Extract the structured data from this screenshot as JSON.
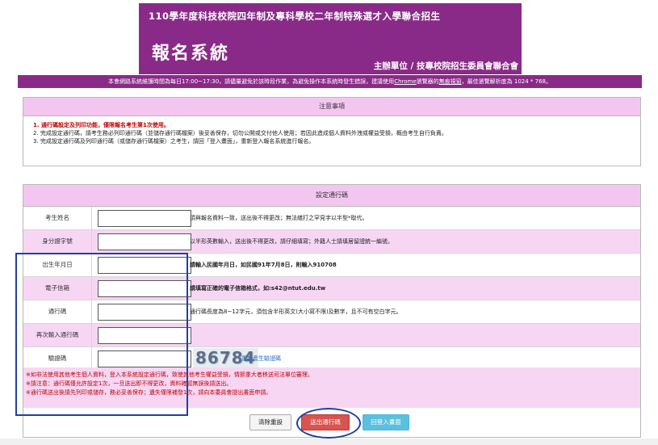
{
  "header": {
    "line1": "110學年度科技校院四年制及專科學校二年制特殊選才入學聯合招生",
    "title": "報名系統",
    "organizer": "主辦單位 / 技專校院招生委員會聯合會",
    "notice_prefix": "本會網路系統維護時間為每日17:00~17:30，請儘量避免於該時段作業，為避免操作本系統時發生錯誤，建議使用",
    "notice_chrome": "Chrome",
    "notice_mid": "瀏覽器的",
    "notice_incognito": "無痕視窗",
    "notice_suffix": "，最佳瀏覽解析度為 1024 * 768。"
  },
  "attention": {
    "heading": "注意事項",
    "items": [
      "1. 通行碼設定及列印功能，僅限報名考生第1次使用。",
      "2. 完成設定通行碼，請考生務必列印通行碼（並儲存通行碼檔案）後妥善保存，切勿公開或交付他人使用；若因此造成個人資料外洩或權益受損，概由考生自行負責。",
      "3. 完成設定通行碼及列印通行碼（或儲存通行碼檔案）之考生，請回「登入畫面」，重新登入報名系統進行報名。"
    ]
  },
  "form": {
    "heading": "設定通行碼",
    "rows": [
      {
        "label": "考生姓名",
        "value": "",
        "hint": "須與報名資料一致，送出後不得更改；無法繕打之罕見字以半型*取代。"
      },
      {
        "label": "身分證字號",
        "value": "",
        "hint": "以半形英數輸入，送出後不得更改，請仔細填寫；外籍人士請填居留證統一編號。"
      },
      {
        "label": "出生年月日",
        "value": "",
        "hint": "請輸入民國年月日，如民國91年7月8日，則輸入910708"
      },
      {
        "label": "電子信箱",
        "value": "",
        "hint": "請填寫正確的電子信箱格式，如:s42@ntut.edu.tw"
      },
      {
        "label": "通行碼",
        "value": "",
        "hint": "通行碼長度為8~12字元，須包含半形英文(大小寫不限)及數字，且不可有空白字元。"
      },
      {
        "label": "再次輸入通行碼",
        "value": "",
        "hint": ""
      },
      {
        "label": "驗證碼",
        "value": "",
        "hint": ""
      }
    ],
    "captcha_code": "86784",
    "captcha_refresh": "重新產生驗證碼",
    "warnings": [
      "※如非法使用其他考生個人資料，登入本系統設定通行碼，致使其他考生權益受損，情節重大者移送司法單位審理。",
      "※請注意：通行碼僅允許設定1次，一旦送出即不得更改，資料確認無誤後請送出。",
      "※通行碼送出後請先列印或儲存，務必妥善保存；遺失僅限補發1次，請向本委員會提出書面申請。"
    ],
    "buttons": {
      "clear": "清除重設",
      "submit": "送出通行碼",
      "back": "回登入畫面"
    }
  },
  "colors": {
    "brand": "#8a2a88",
    "header_pink": "#f3c6ef",
    "row_pink": "#f7d6f3",
    "warning_red": "#c00000",
    "submit": "#d9534f",
    "back": "#5bc0de",
    "annotation_blue": "#1f3fa8"
  }
}
